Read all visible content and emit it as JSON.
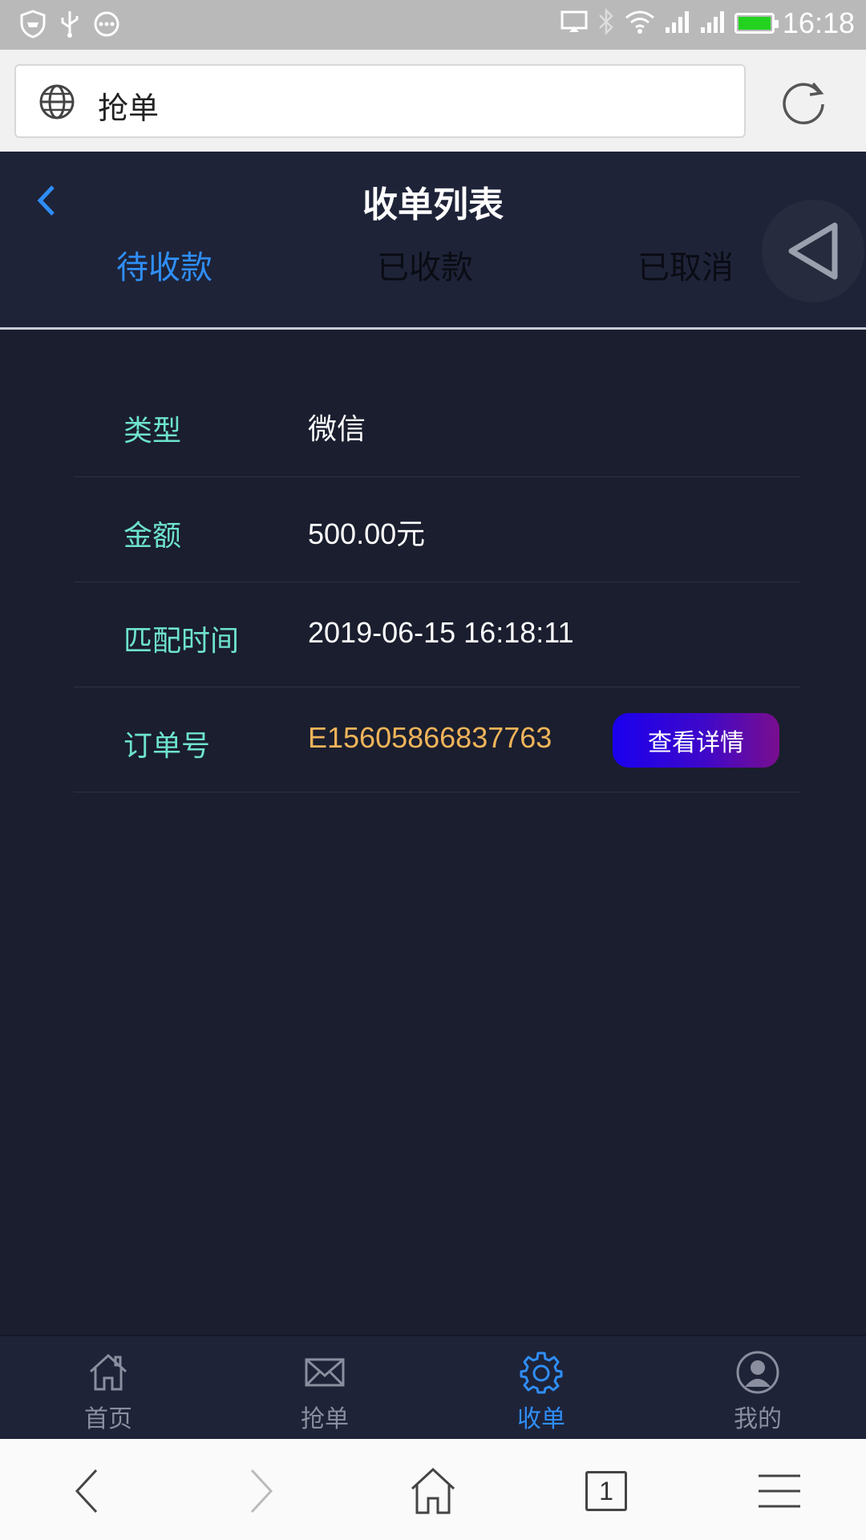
{
  "status_bar": {
    "time": "16:18",
    "icons": [
      "shield-icon",
      "usb-icon",
      "more-icon",
      "cast-icon",
      "bluetooth-icon",
      "wifi-icon",
      "signal-icon",
      "signal-icon",
      "battery-icon"
    ]
  },
  "browser": {
    "url_text": "抢单",
    "tab_count": "1"
  },
  "header": {
    "title": "收单列表",
    "tabs": [
      {
        "label": "待收款",
        "active": true
      },
      {
        "label": "已收款",
        "active": false
      },
      {
        "label": "已取消",
        "active": false
      }
    ]
  },
  "order": {
    "rows": [
      {
        "label": "类型",
        "value": "微信"
      },
      {
        "label": "金额",
        "value": "500.00元"
      },
      {
        "label": "匹配时间",
        "value": "2019-06-15 16:18:11"
      },
      {
        "label": "订单号",
        "value": "E15605866837763"
      }
    ],
    "detail_button": "查看详情"
  },
  "bottom_nav": {
    "items": [
      {
        "label": "首页",
        "icon": "home-icon",
        "active": false
      },
      {
        "label": "抢单",
        "icon": "mail-icon",
        "active": false
      },
      {
        "label": "收单",
        "icon": "gear-icon",
        "active": true
      },
      {
        "label": "我的",
        "icon": "user-icon",
        "active": false
      }
    ]
  },
  "colors": {
    "accent": "#2f8ef7",
    "label": "#6ee3cf",
    "order_number": "#f0b45a",
    "background": "#1a1e2e"
  }
}
